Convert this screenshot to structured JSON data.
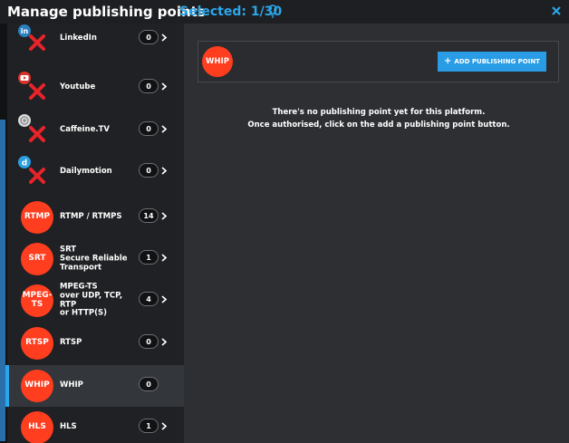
{
  "header": {
    "title": "Manage publishing points",
    "selected": "Selected: 1/30"
  },
  "sidebar": {
    "items": [
      {
        "label": "LinkedIn",
        "count": "0",
        "icon": "linkedin-icon",
        "badge": "in"
      },
      {
        "label": "Youtube",
        "count": "0",
        "icon": "youtube-icon",
        "badge": "You Tube"
      },
      {
        "label": "Caffeine.TV",
        "count": "0",
        "icon": "caffeine-icon"
      },
      {
        "label": "Dailymotion",
        "count": "0",
        "icon": "dailymotion-icon",
        "badge": "d"
      },
      {
        "label": "RTMP / RTMPS",
        "count": "14",
        "circle": "RTMP"
      },
      {
        "label": "SRT\nSecure Reliable\nTransport",
        "count": "1",
        "circle": "SRT"
      },
      {
        "label": "MPEG-TS\nover UDP, TCP, RTP\nor HTTP(S)",
        "count": "4",
        "circle": "MPEG-\nTS"
      },
      {
        "label": "RTSP",
        "count": "0",
        "circle": "RTSP"
      },
      {
        "label": "WHIP",
        "count": "0",
        "circle": "WHIP",
        "active": true
      },
      {
        "label": "HLS",
        "count": "1",
        "circle": "HLS"
      }
    ]
  },
  "main": {
    "platform": "WHIP",
    "add_button": "ADD PUBLISHING POINT",
    "add_button_icon": "+",
    "empty_line1": "There's no publishing point yet for this platform.",
    "empty_line2": "Once authorised, click on the add a publishing point button."
  },
  "colors": {
    "accent": "#2aa7ea",
    "platform_red": "#ff3d1f",
    "error_red": "#e8232a"
  }
}
